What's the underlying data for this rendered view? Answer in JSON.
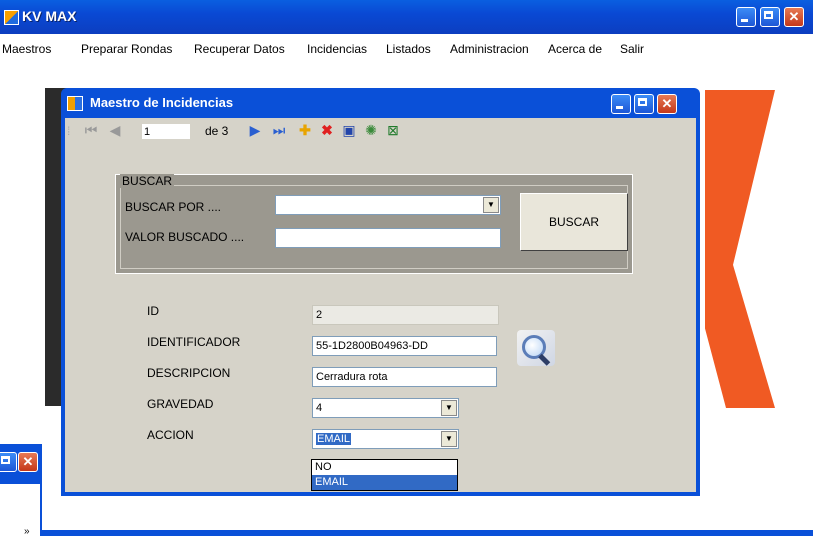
{
  "main_window": {
    "title": "KV MAX",
    "icon": "app-icon",
    "controls": {
      "minimize": "minimize-icon",
      "maximize": "maximize-icon",
      "close": "close-icon"
    }
  },
  "menu": {
    "items": [
      "Maestros",
      "Preparar Rondas",
      "Recuperar Datos",
      "Incidencias",
      "Listados",
      "Administracion",
      "Acerca de",
      "Salir"
    ]
  },
  "child_window": {
    "title": "Maestro de Incidencias",
    "toolbar": {
      "position": "1",
      "of_count": "de 3",
      "icons": [
        "first-icon",
        "prev-icon",
        "next-icon",
        "last-icon",
        "add-icon",
        "delete-icon",
        "save-icon",
        "refresh-icon",
        "excel-icon"
      ]
    },
    "search_group": {
      "legend": "BUSCAR",
      "search_by_label": "BUSCAR POR ....",
      "search_by_value": "",
      "search_value_label": "VALOR BUSCADO ....",
      "search_value": "",
      "button_label": "BUSCAR"
    },
    "form": {
      "id_label": "ID",
      "id_value": "2",
      "identifier_label": "IDENTIFICADOR",
      "identifier_value": "55-1D2800B04963-DD",
      "description_label": "DESCRIPCION",
      "description_value": "Cerradura rota",
      "severity_label": "GRAVEDAD",
      "severity_value": "4",
      "action_label": "ACCION",
      "action_value": "EMAIL",
      "action_options": [
        "NO",
        "EMAIL"
      ]
    }
  },
  "colors": {
    "title_blue": "#0a50d8",
    "panel_gray": "#d6d3c9",
    "group_gray": "#9b988f",
    "selection_blue": "#316ac5",
    "logo_orange": "#f05a23"
  }
}
